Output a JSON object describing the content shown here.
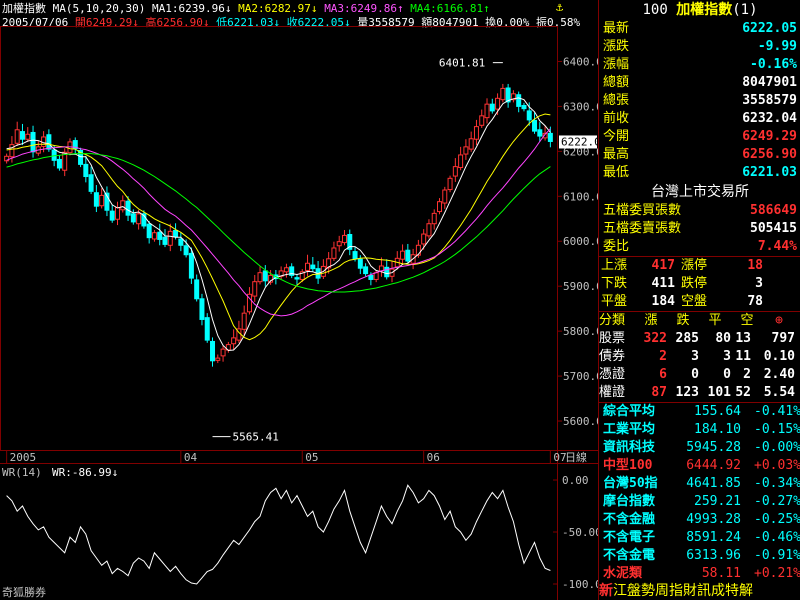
{
  "header": {
    "name": "加權指數",
    "ma_label": "MA(5,10,20,30)",
    "ma1": "MA1:6239.96↓",
    "ma2": "MA2:6282.97↓",
    "ma3": "MA3:6249.86↑",
    "ma4": "MA4:6166.81↑",
    "date": "2005/07/06",
    "open": "開6249.29↓",
    "high": "高6256.90↓",
    "low": "低6221.03↓",
    "close": "收6222.05↓",
    "vol": "量3558579",
    "amount": "額8047901",
    "turnover": "換0.00%",
    "amp": "振0.58%",
    "pin_icon": "pin-icon"
  },
  "chart_data": [
    {
      "type": "candlestick",
      "title": "加權指數",
      "indicators": [
        "MA1",
        "MA2",
        "MA3",
        "MA4"
      ],
      "colors": {
        "up": "#ff3333",
        "down": "#00ffff",
        "ma1": "#ffffff",
        "ma2": "#ffff00",
        "ma3": "#ff44ff",
        "ma4": "#00ff00"
      },
      "ylim": [
        5540,
        6470
      ],
      "yticks": [
        5600,
        5700,
        5800,
        5900,
        6000,
        6100,
        6200,
        6300,
        6400
      ],
      "ytick_labels": [
        "5600.0",
        "5700.0",
        "5800.0",
        "5900.0",
        "6000.0",
        "6100.0",
        "6200.0",
        "6300.0",
        "6400.0"
      ],
      "xtick_labels": [
        "2005",
        "04",
        "05",
        "06",
        "07"
      ],
      "xtick_bar_index": [
        0,
        33,
        56,
        79,
        103
      ],
      "x_unit_label": "日線",
      "annotations": {
        "max": "6401.81",
        "min": "5565.41",
        "last": "6222.0"
      },
      "close": [
        6189,
        6215,
        6248,
        6227,
        6238,
        6199,
        6210,
        6232,
        6205,
        6180,
        6163,
        6198,
        6221,
        6206,
        6171,
        6144,
        6111,
        6078,
        6102,
        6069,
        6047,
        6075,
        6090,
        6058,
        6043,
        6061,
        6034,
        6008,
        6019,
        6004,
        5993,
        6022,
        6010,
        5991,
        5970,
        5918,
        5872,
        5826,
        5780,
        5734,
        5740,
        5760,
        5770,
        5785,
        5805,
        5840,
        5882,
        5910,
        5930,
        5912,
        5924,
        5917,
        5934,
        5941,
        5924,
        5916,
        5932,
        5951,
        5939,
        5918,
        5944,
        5961,
        5985,
        5999,
        6013,
        5982,
        5961,
        5940,
        5928,
        5915,
        5930,
        5945,
        5921,
        5938,
        5962,
        5978,
        5956,
        5970,
        5991,
        6016,
        6039,
        6062,
        6088,
        6114,
        6140,
        6166,
        6192,
        6210,
        6228,
        6255,
        6279,
        6305,
        6290,
        6318,
        6340,
        6310,
        6328,
        6300,
        6295,
        6270,
        6245,
        6234,
        6240,
        6222
      ],
      "ma1": [
        6206,
        6208,
        6214,
        6217,
        6223,
        6225,
        6224,
        6219,
        6217,
        6205,
        6198,
        6196,
        6193,
        6194,
        6188,
        6188,
        6170,
        6142,
        6121,
        6101,
        6081,
        6074,
        6077,
        6069,
        6063,
        6065,
        6057,
        6041,
        6033,
        6025,
        6012,
        6011,
        6009,
        6009,
        5997,
        5982,
        5952,
        5915,
        5873,
        5826,
        5790,
        5768,
        5757,
        5758,
        5770,
        5790,
        5816,
        5844,
        5873,
        5897,
        5912,
        5919,
        5923,
        5926,
        5928,
        5926,
        5929,
        5933,
        5932,
        5928,
        5933,
        5943,
        5948,
        5958,
        5980,
        5988,
        5988,
        5980,
        5965,
        5945,
        5935,
        5932,
        5928,
        5930,
        5939,
        5949,
        5951,
        5961,
        5971,
        5986,
        6002,
        6017,
        6040,
        6064,
        6089,
        6114,
        6140,
        6166,
        6189,
        6210,
        6233,
        6256,
        6271,
        6289,
        6306,
        6313,
        6317,
        6319,
        6315,
        6299,
        6288,
        6268,
        6257,
        6242
      ],
      "ma2": [
        6203,
        6205,
        6206,
        6209,
        6211,
        6214,
        6216,
        6216,
        6216,
        6213,
        6211,
        6210,
        6206,
        6205,
        6197,
        6193,
        6187,
        6178,
        6168,
        6153,
        6137,
        6122,
        6111,
        6095,
        6082,
        6072,
        6065,
        6058,
        6050,
        6044,
        6039,
        6034,
        6026,
        6020,
        6011,
        6002,
        5983,
        5963,
        5941,
        5917,
        5892,
        5867,
        5839,
        5812,
        5797,
        5786,
        5781,
        5786,
        5794,
        5807,
        5826,
        5842,
        5858,
        5874,
        5889,
        5902,
        5912,
        5920,
        5926,
        5927,
        5929,
        5933,
        5938,
        5944,
        5953,
        5958,
        5960,
        5962,
        5963,
        5962,
        5960,
        5959,
        5958,
        5956,
        5953,
        5950,
        5949,
        5948,
        5950,
        5953,
        5957,
        5963,
        5974,
        5987,
        6002,
        6019,
        6035,
        6053,
        6071,
        6092,
        6112,
        6133,
        6151,
        6170,
        6189,
        6206,
        6222,
        6236,
        6249,
        6262,
        6272,
        6279,
        6283,
        6281
      ],
      "ma3": [
        6180,
        6185,
        6189,
        6194,
        6197,
        6200,
        6203,
        6205,
        6207,
        6208,
        6209,
        6210,
        6210,
        6209,
        6206,
        6204,
        6200,
        6196,
        6191,
        6186,
        6178,
        6169,
        6160,
        6150,
        6139,
        6129,
        6118,
        6105,
        6093,
        6082,
        6071,
        6063,
        6056,
        6046,
        6035,
        6025,
        6012,
        5998,
        5985,
        5971,
        5957,
        5943,
        5929,
        5914,
        5901,
        5886,
        5873,
        5860,
        5851,
        5844,
        5838,
        5836,
        5834,
        5835,
        5838,
        5843,
        5849,
        5857,
        5863,
        5870,
        5876,
        5883,
        5889,
        5894,
        5899,
        5905,
        5910,
        5916,
        5921,
        5926,
        5930,
        5934,
        5937,
        5940,
        5942,
        5944,
        5946,
        5949,
        5952,
        5956,
        5960,
        5965,
        5972,
        5981,
        5990,
        6000,
        6012,
        6024,
        6037,
        6050,
        6064,
        6079,
        6093,
        6106,
        6119,
        6133,
        6148,
        6163,
        6176,
        6190,
        6205,
        6222,
        6238,
        6250
      ],
      "ma4": [
        6165,
        6168,
        6172,
        6175,
        6178,
        6181,
        6183,
        6186,
        6188,
        6190,
        6191,
        6193,
        6194,
        6195,
        6195,
        6195,
        6195,
        6194,
        6192,
        6190,
        6187,
        6184,
        6180,
        6175,
        6170,
        6164,
        6158,
        6151,
        6144,
        6136,
        6128,
        6120,
        6112,
        6103,
        6094,
        6084,
        6075,
        6064,
        6053,
        6042,
        6031,
        6019,
        6008,
        5997,
        5986,
        5975,
        5965,
        5955,
        5945,
        5936,
        5928,
        5921,
        5915,
        5909,
        5904,
        5900,
        5897,
        5894,
        5892,
        5890,
        5889,
        5888,
        5887,
        5887,
        5887,
        5888,
        5889,
        5890,
        5892,
        5894,
        5896,
        5899,
        5902,
        5905,
        5908,
        5912,
        5916,
        5920,
        5925,
        5930,
        5936,
        5942,
        5948,
        5955,
        5963,
        5971,
        5980,
        5990,
        6000,
        6010,
        6021,
        6032,
        6044,
        6056,
        6068,
        6081,
        6094,
        6106,
        6118,
        6129,
        6140,
        6150,
        6158,
        6166
      ]
    },
    {
      "type": "line",
      "title": "WR(14)",
      "value_label": "WR:-86.99↓",
      "ylim": [
        -100,
        0
      ],
      "yticks": [
        0,
        -50,
        -100
      ],
      "ytick_labels": [
        "0.00",
        "-50.00",
        "-100.00"
      ],
      "values": [
        -15,
        -20,
        -30,
        -25,
        -35,
        -42,
        -48,
        -45,
        -55,
        -60,
        -65,
        -70,
        -55,
        -60,
        -45,
        -52,
        -68,
        -75,
        -82,
        -78,
        -90,
        -85,
        -88,
        -92,
        -80,
        -75,
        -78,
        -85,
        -70,
        -76,
        -82,
        -88,
        -83,
        -90,
        -96,
        -99,
        -100,
        -94,
        -88,
        -86,
        -80,
        -72,
        -65,
        -58,
        -62,
        -55,
        -48,
        -40,
        -35,
        -20,
        -12,
        -8,
        -18,
        -10,
        -22,
        -15,
        -25,
        -35,
        -30,
        -45,
        -50,
        -40,
        -28,
        -20,
        -10,
        -30,
        -45,
        -60,
        -70,
        -55,
        -40,
        -25,
        -35,
        -42,
        -30,
        -20,
        -5,
        -12,
        -22,
        -18,
        -10,
        -15,
        -25,
        -38,
        -30,
        -45,
        -50,
        -58,
        -52,
        -40,
        -30,
        -20,
        -12,
        -18,
        -10,
        -26,
        -40,
        -62,
        -80,
        -70,
        -60,
        -75,
        -85,
        -87
      ]
    }
  ],
  "footer": {
    "brand": "奇狐勝券"
  },
  "panel": {
    "title_code": "100",
    "title_name": "加權指數",
    "title_num": "(1)",
    "quote": [
      {
        "label": "最新",
        "value": "6222.05",
        "color": "cyn"
      },
      {
        "label": "漲跌",
        "value": "-9.99",
        "color": "cyn"
      },
      {
        "label": "漲幅",
        "value": "-0.16%",
        "color": "cyn"
      },
      {
        "label": "總額",
        "value": "8047901",
        "color": "wht"
      },
      {
        "label": "總張",
        "value": "3558579",
        "color": "wht"
      },
      {
        "label": "前收",
        "value": "6232.04",
        "color": "wht"
      },
      {
        "label": "今開",
        "value": "6249.29",
        "color": "red"
      },
      {
        "label": "最高",
        "value": "6256.90",
        "color": "red"
      },
      {
        "label": "最低",
        "value": "6221.03",
        "color": "cyn"
      }
    ],
    "market_title": "台灣上市交易所",
    "book": [
      {
        "label": "五檔委買張數",
        "value": "586649",
        "color": "red"
      },
      {
        "label": "五檔委賣張數",
        "value": "505415",
        "color": "wht"
      },
      {
        "label": "委比",
        "value": "7.44%",
        "color": "red"
      }
    ],
    "updown": [
      {
        "l1": "上漲",
        "v1": "417",
        "c1": "red",
        "l2": "漲停",
        "v2": "18",
        "c2": "red"
      },
      {
        "l1": "下跌",
        "v1": "411",
        "c1": "wht",
        "l2": "跌停",
        "v2": "3",
        "c2": "wht"
      },
      {
        "l1": "平盤",
        "v1": "184",
        "c1": "wht",
        "l2": "空盤",
        "v2": "78",
        "c2": "wht"
      }
    ],
    "cls_header": [
      "分類",
      "漲",
      "跌",
      "平",
      "空",
      "額"
    ],
    "cls_rows": [
      {
        "name": "股票",
        "up": "322",
        "dn": "285",
        "flat": "80",
        "empty": "13",
        "amt": "797"
      },
      {
        "name": "債券",
        "up": "2",
        "dn": "3",
        "flat": "3",
        "empty": "11",
        "amt": "0.10"
      },
      {
        "name": "憑證",
        "up": "6",
        "dn": "0",
        "flat": "0",
        "empty": "2",
        "amt": "2.40"
      },
      {
        "name": "權證",
        "up": "87",
        "dn": "123",
        "flat": "101",
        "empty": "52",
        "amt": "5.54"
      }
    ],
    "indices": [
      {
        "name": "綜合平均",
        "value": "155.64",
        "chg": "-0.41%",
        "color": "cyn"
      },
      {
        "name": "工業平均",
        "value": "184.10",
        "chg": "-0.15%",
        "color": "cyn"
      },
      {
        "name": "資訊科技",
        "value": "5945.28",
        "chg": "-0.00%",
        "color": "cyn"
      },
      {
        "name": "中型100",
        "value": "6444.92",
        "chg": "+0.03%",
        "color": "red"
      },
      {
        "name": "台灣50指",
        "value": "4641.85",
        "chg": "-0.34%",
        "color": "cyn"
      },
      {
        "name": "摩台指數",
        "value": "259.21",
        "chg": "-0.27%",
        "color": "cyn"
      },
      {
        "name": "不含金融",
        "value": "4993.28",
        "chg": "-0.25%",
        "color": "cyn"
      },
      {
        "name": "不含電子",
        "value": "8591.24",
        "chg": "-0.46%",
        "color": "cyn"
      },
      {
        "name": "不含金電",
        "value": "6313.96",
        "chg": "-0.91%",
        "color": "cyn"
      },
      {
        "name": "水泥類",
        "value": "58.11",
        "chg": "+0.21%",
        "color": "red"
      }
    ],
    "ticker_prefix": "新",
    "ticker_text": "江盤勢周指財訊成特解"
  }
}
